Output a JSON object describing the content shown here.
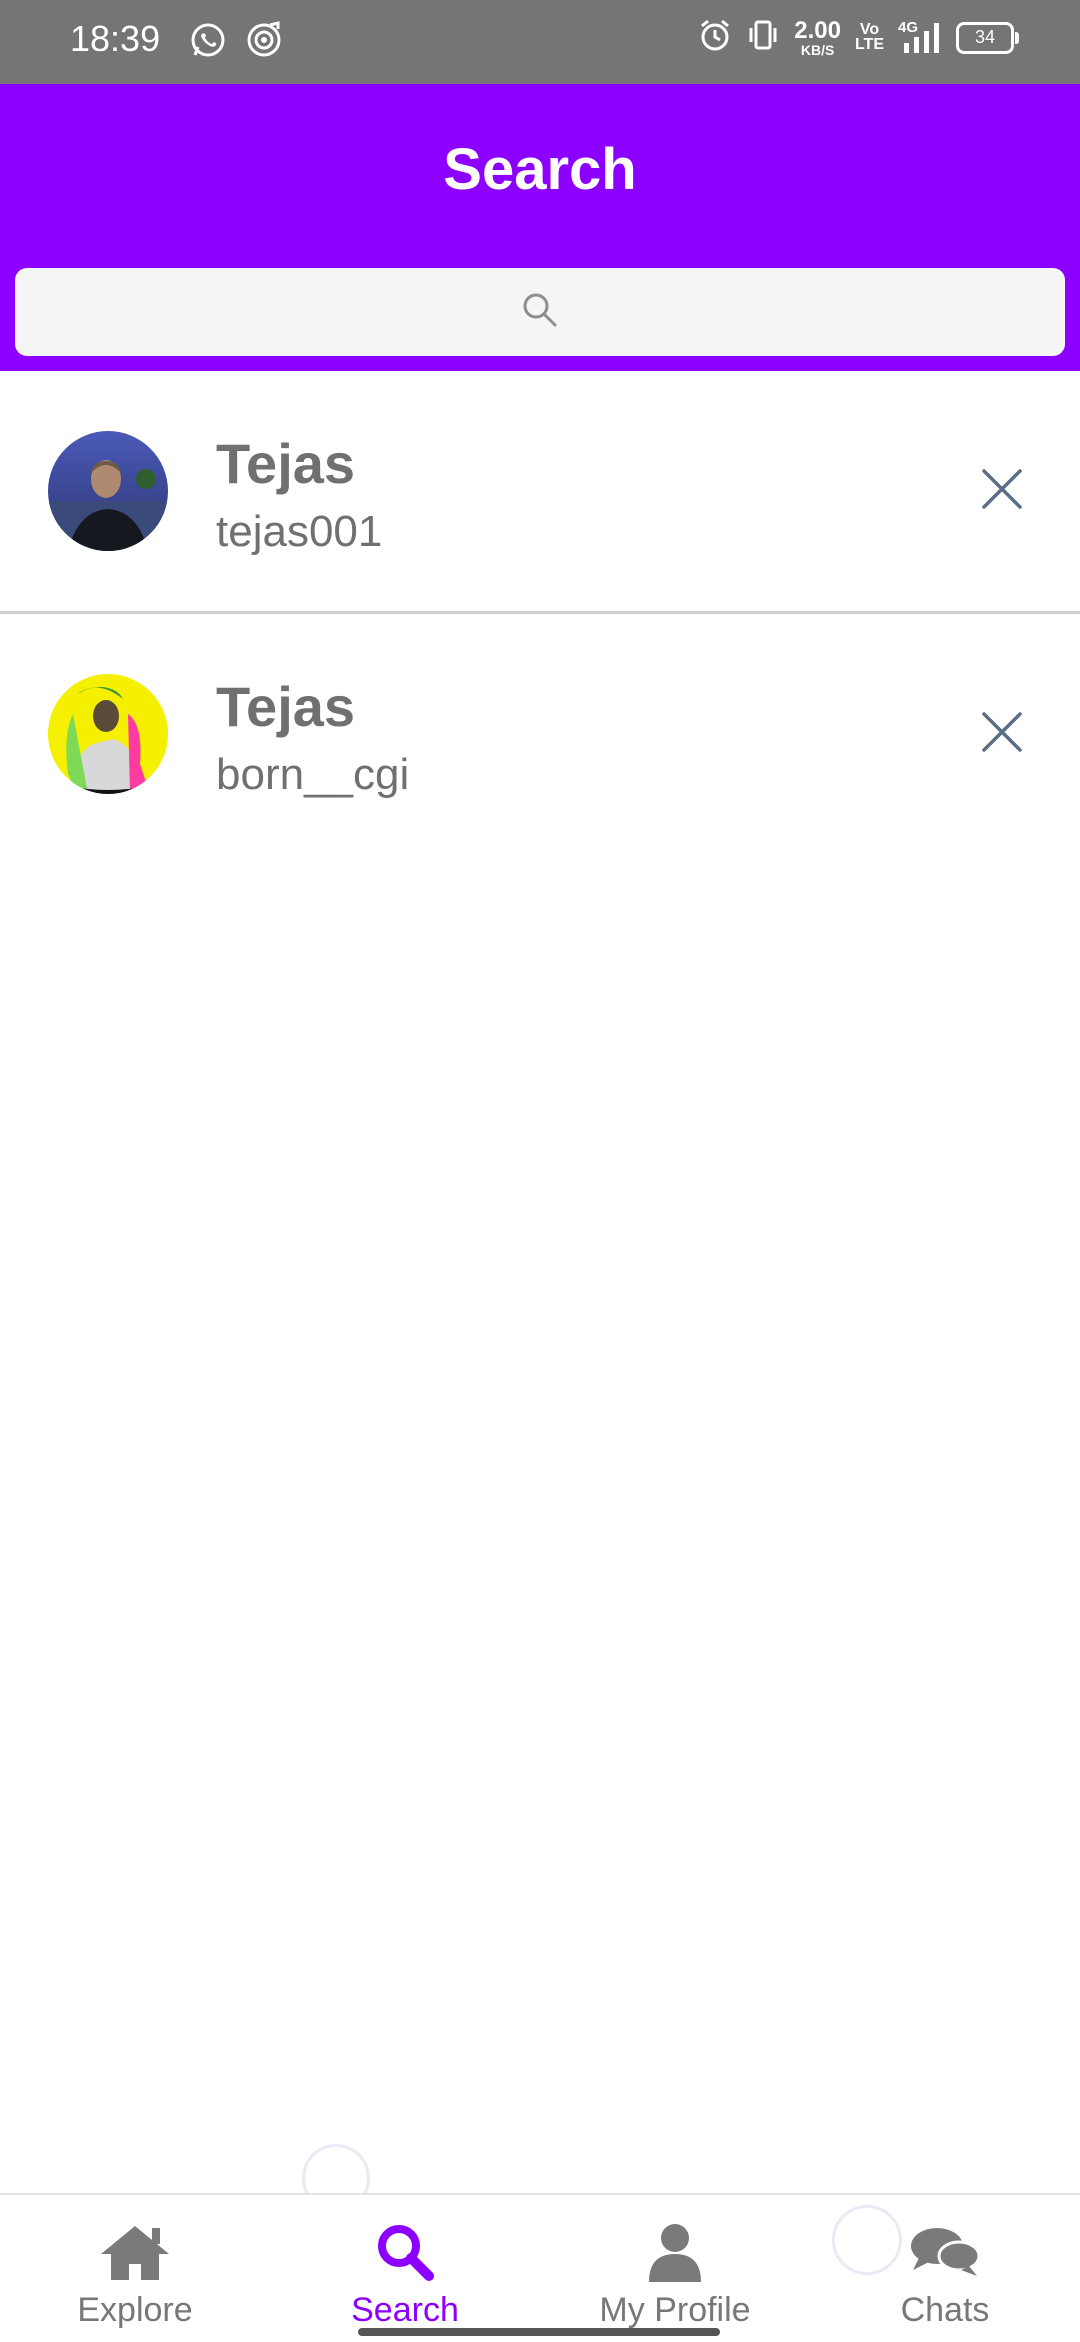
{
  "status_bar": {
    "time": "18:39",
    "net_speed": "2.00",
    "net_unit": "KB/S",
    "volte_top": "Vo",
    "volte_bottom": "LTE",
    "network": "4G",
    "battery": "34"
  },
  "header": {
    "title": "Search",
    "search_placeholder": ""
  },
  "results": [
    {
      "name": "Tejas",
      "username": "tejas001"
    },
    {
      "name": "Tejas",
      "username": "born__cgi"
    }
  ],
  "nav": {
    "items": [
      {
        "label": "Explore",
        "icon": "home-icon"
      },
      {
        "label": "Search",
        "icon": "search-icon"
      },
      {
        "label": "My Profile",
        "icon": "person-icon"
      },
      {
        "label": "Chats",
        "icon": "chat-bubbles-icon"
      }
    ],
    "active_index": 1
  },
  "colors": {
    "accent": "#8b00ff",
    "status_bar": "#757575",
    "text_gray": "#707070",
    "remove_icon": "#5a6f85"
  }
}
